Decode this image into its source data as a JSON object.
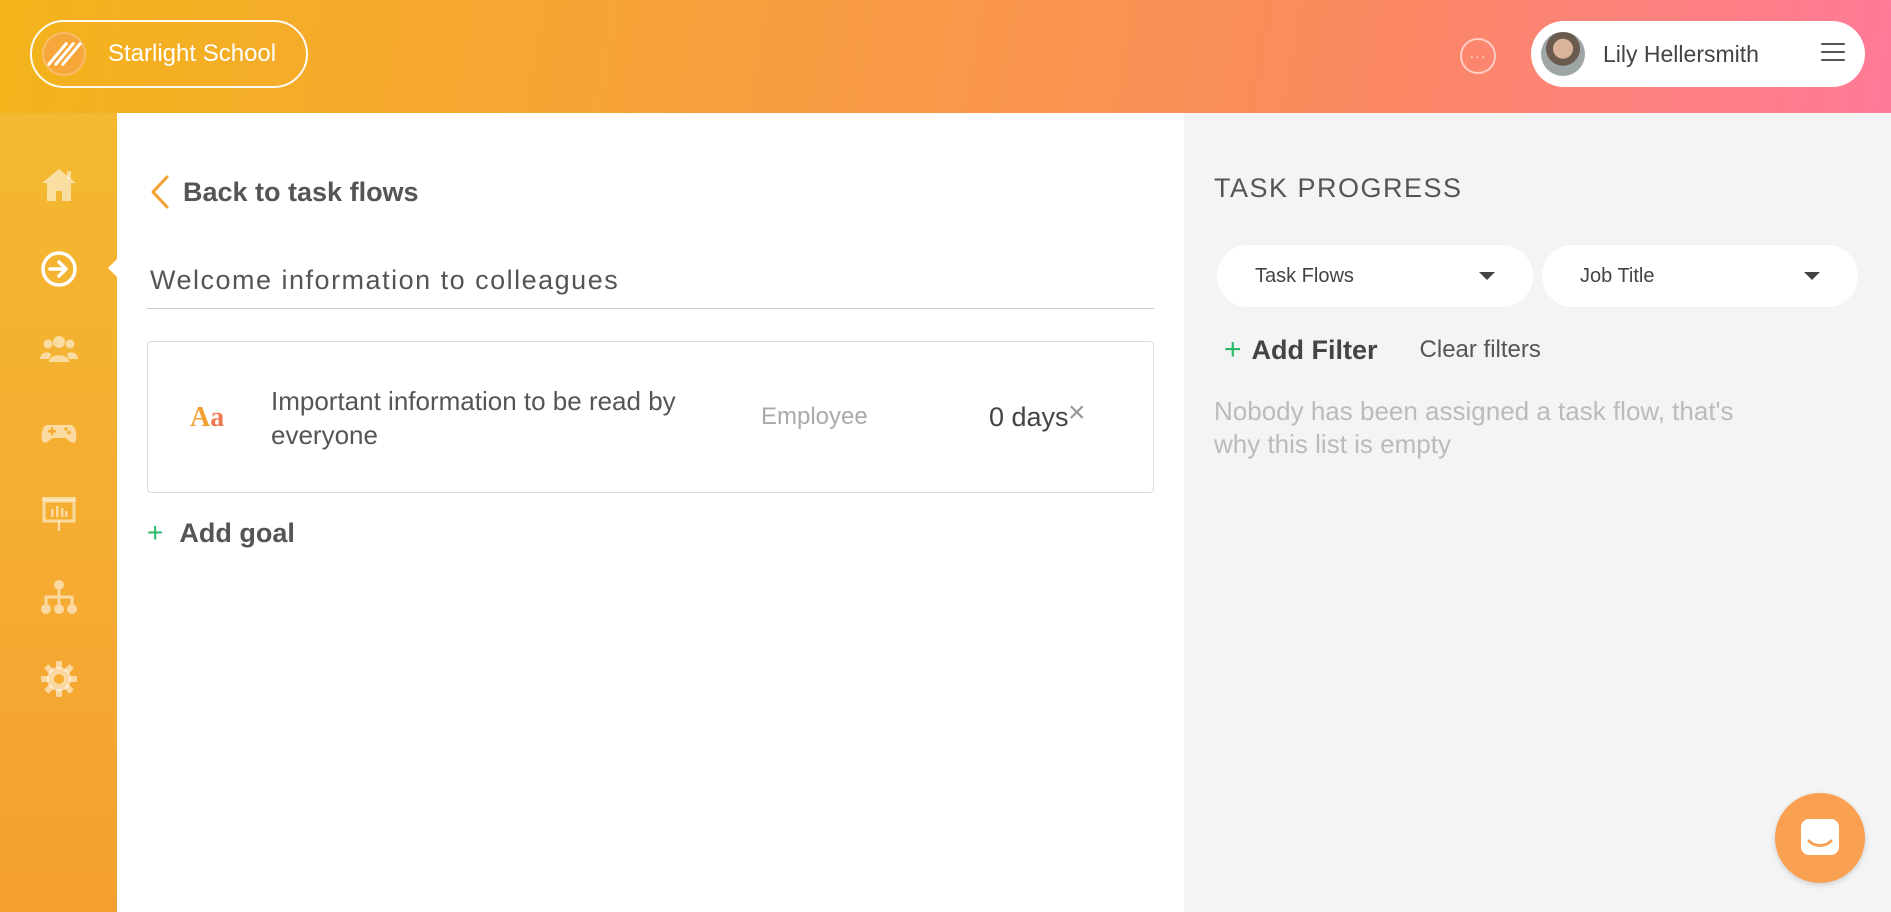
{
  "header": {
    "brand_name": "Starlight School",
    "more_label": "···",
    "user_name": "Lily Hellersmith"
  },
  "sidebar": {
    "items": [
      {
        "icon": "home-icon"
      },
      {
        "icon": "task-flow-icon",
        "active": true
      },
      {
        "icon": "people-icon"
      },
      {
        "icon": "gamepad-icon"
      },
      {
        "icon": "presentation-icon"
      },
      {
        "icon": "org-chart-icon"
      },
      {
        "icon": "gear-icon"
      }
    ]
  },
  "main": {
    "back_label": "Back to task flows",
    "title": "Welcome information to colleagues",
    "goals": [
      {
        "icon_text_a": "A",
        "icon_text_b": "a",
        "text": "Important information to be read by everyone",
        "role": "Employee",
        "duration": "0 days",
        "remove": "×"
      }
    ],
    "add_goal_icon": "+",
    "add_goal_label": "Add goal"
  },
  "progress": {
    "title": "TASK PROGRESS",
    "selects": [
      {
        "value": "Task Flows"
      },
      {
        "value": "Job Title"
      }
    ],
    "add_filter_icon": "+",
    "add_filter_label": "Add Filter",
    "clear_filters_label": "Clear filters",
    "empty_message": "Nobody has been assigned a task flow, that's why this list is empty"
  },
  "colors": {
    "accent": "#f4a030",
    "positive": "#2ab86a"
  }
}
